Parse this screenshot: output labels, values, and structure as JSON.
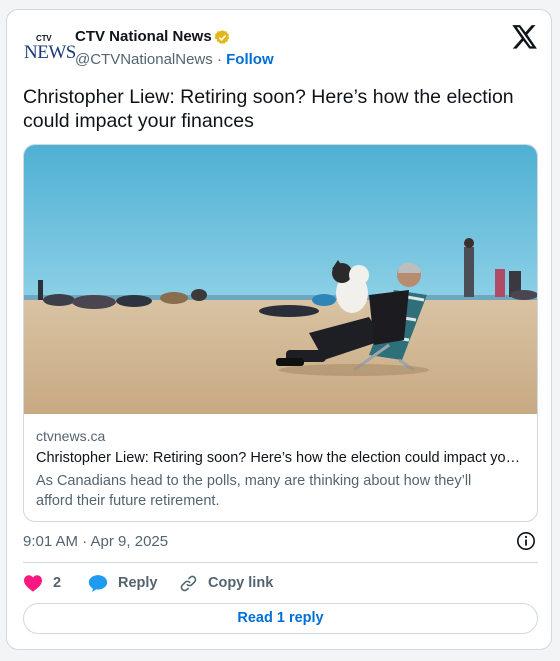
{
  "author": {
    "logo_top": "CTV",
    "logo_bottom": "NEWS",
    "display_name": "CTV National News",
    "handle": "@CTVNationalNews",
    "separator": "·",
    "follow_label": "Follow"
  },
  "tweet": {
    "text": "Christopher Liew: Retiring soon? Here’s how the election could impact your finances",
    "timestamp": "9:01 AM · Apr 9, 2025"
  },
  "link_card": {
    "domain": "ctvnews.ca",
    "title": "Christopher Liew: Retiring soon? Here’s how the election could impact your finances",
    "description": "As Canadians head to the polls, many are thinking about how they’ll afford their future retirement.",
    "image_icon": "beach-photo"
  },
  "actions": {
    "like_count": "2",
    "reply_label": "Reply",
    "copy_link_label": "Copy link",
    "read_replies_label": "Read 1 reply"
  },
  "colors": {
    "accent": "#006fd6",
    "muted": "#536471",
    "like": "#f91880",
    "reply_bubble": "#1d9bf0"
  }
}
